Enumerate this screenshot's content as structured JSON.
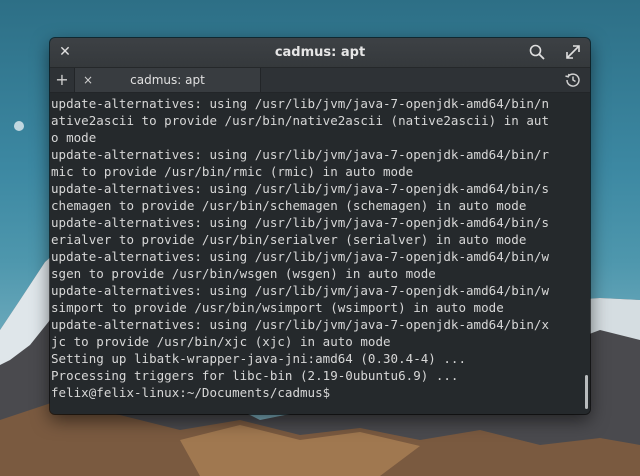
{
  "window": {
    "title": "cadmus: apt",
    "close_icon": "close-icon",
    "search_icon": "search-icon",
    "fullscreen_icon": "fullscreen-icon"
  },
  "tabs": {
    "new_tab_symbol": "+",
    "items": [
      {
        "label": "cadmus: apt",
        "close_symbol": "×"
      }
    ],
    "history_icon": "history-icon"
  },
  "terminal": {
    "lines": [
      "update-alternatives: using /usr/lib/jvm/java-7-openjdk-amd64/bin/n",
      "ative2ascii to provide /usr/bin/native2ascii (native2ascii) in aut",
      "o mode",
      "update-alternatives: using /usr/lib/jvm/java-7-openjdk-amd64/bin/r",
      "mic to provide /usr/bin/rmic (rmic) in auto mode",
      "update-alternatives: using /usr/lib/jvm/java-7-openjdk-amd64/bin/s",
      "chemagen to provide /usr/bin/schemagen (schemagen) in auto mode",
      "update-alternatives: using /usr/lib/jvm/java-7-openjdk-amd64/bin/s",
      "erialver to provide /usr/bin/serialver (serialver) in auto mode",
      "update-alternatives: using /usr/lib/jvm/java-7-openjdk-amd64/bin/w",
      "sgen to provide /usr/bin/wsgen (wsgen) in auto mode",
      "update-alternatives: using /usr/lib/jvm/java-7-openjdk-amd64/bin/w",
      "simport to provide /usr/bin/wsimport (wsimport) in auto mode",
      "update-alternatives: using /usr/lib/jvm/java-7-openjdk-amd64/bin/x",
      "jc to provide /usr/bin/xjc (xjc) in auto mode",
      "Setting up libatk-wrapper-java-jni:amd64 (0.30.4-4) ...",
      "Processing triggers for libc-bin (2.19-0ubuntu6.9) ...",
      "felix@felix-linux:~/Documents/cadmus$"
    ]
  },
  "colors": {
    "terminal_bg": "#25292c",
    "terminal_fg": "#d7d7d7",
    "titlebar_bg": "#3d4145"
  }
}
